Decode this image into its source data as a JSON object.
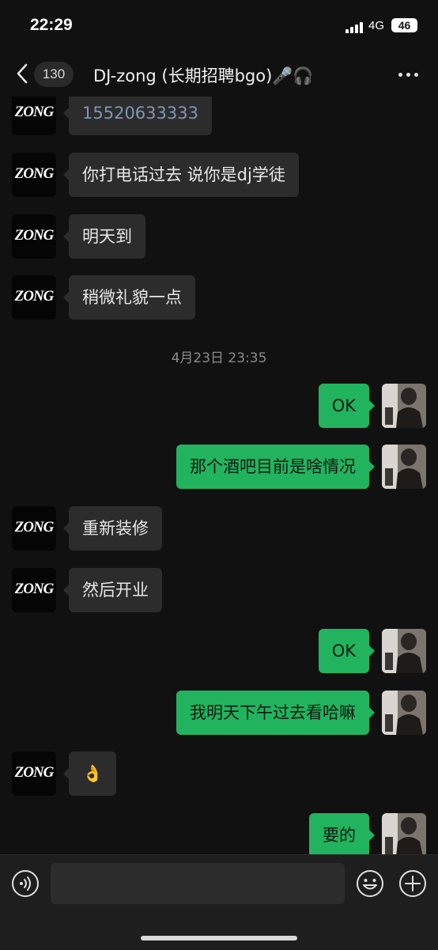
{
  "status_bar": {
    "time": "22:29",
    "network": "4G",
    "battery": "46"
  },
  "header": {
    "unread_count": "130",
    "title": "DJ-zong (长期招聘bgo)🎤🎧"
  },
  "contact_avatar_text": "ZONG",
  "messages": [
    {
      "side": "left",
      "text": "15520633333",
      "kind": "phone"
    },
    {
      "side": "left",
      "text": "你打电话过去 说你是dj学徒"
    },
    {
      "side": "left",
      "text": "明天到"
    },
    {
      "side": "left",
      "text": "稍微礼貌一点"
    },
    {
      "side": "right",
      "text": "OK"
    },
    {
      "side": "right",
      "text": "那个酒吧目前是啥情况"
    },
    {
      "side": "left",
      "text": "重新装修"
    },
    {
      "side": "left",
      "text": "然后开业"
    },
    {
      "side": "right",
      "text": "OK"
    },
    {
      "side": "right",
      "text": "我明天下午过去看哈嘛"
    },
    {
      "side": "left",
      "text": "👌"
    },
    {
      "side": "right",
      "text": "要的"
    }
  ],
  "timestamp": "4月23日 23:35",
  "input": {
    "value": "",
    "placeholder": ""
  },
  "colors": {
    "background": "#111111",
    "incoming_bubble": "#2c2c2c",
    "outgoing_bubble": "#21b35e",
    "phone_link": "#7f95b8",
    "timestamp": "#8a8a8a",
    "input_bar": "#1e1e1e"
  },
  "icons": {
    "back": "chevron-left-icon",
    "more": "more-dots-icon",
    "voice": "voice-icon",
    "emoji": "emoji-icon",
    "plus": "plus-icon"
  }
}
